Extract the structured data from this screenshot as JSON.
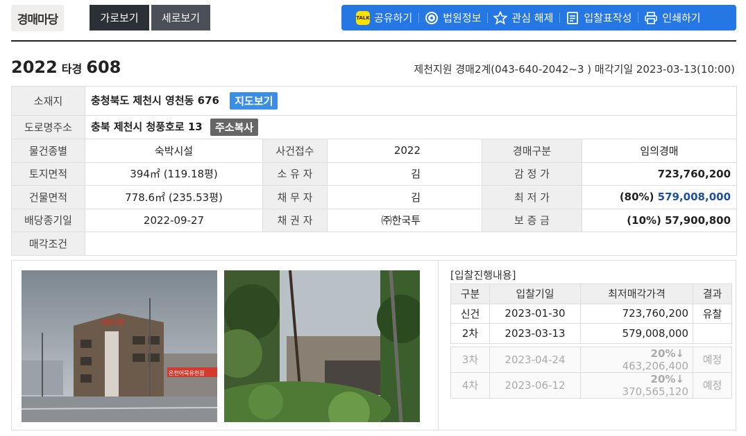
{
  "header": {
    "logo_text": "경매마당",
    "view_horizontal": "가로보기",
    "view_vertical": "세로보기",
    "actions": [
      {
        "icon": "kakao-icon",
        "label": "공유하기"
      },
      {
        "icon": "court-icon",
        "label": "법원정보"
      },
      {
        "icon": "star-icon",
        "label": "관심 해제"
      },
      {
        "icon": "form-icon",
        "label": "입찰표작성"
      },
      {
        "icon": "printer-icon",
        "label": "인쇄하기"
      }
    ],
    "kakao_badge": "TALK"
  },
  "case": {
    "year": "2022",
    "type": "타경",
    "number": "608",
    "court_info": "제천지원 경매2계(043-640-2042~3 ) 매각기일 2023-03-13(10:00)"
  },
  "info": {
    "address_label": "소재지",
    "address_value": "충청북도 제천시 영천동 676",
    "map_button": "지도보기",
    "road_label": "도로명주소",
    "road_value": "충북 제천시 청풍호로 13",
    "copy_button": "주소복사",
    "rows": [
      {
        "l1": "물건종별",
        "v1": "숙박시설",
        "l2": "사건접수",
        "v2": "2022",
        "l3": "경매구분",
        "v3": "임의경매"
      },
      {
        "l1": "토지면적",
        "v1": "394㎡ (119.18평)",
        "l2": "소 유 자",
        "v2": "김",
        "l3": "감 정 가",
        "v3": "723,760,200"
      },
      {
        "l1": "건물면적",
        "v1": "778.6㎡ (235.53평)",
        "l2": "채 무 자",
        "v2": "김",
        "l3": "최 저 가",
        "v3_pct": "(80%)",
        "v3": "579,008,000"
      },
      {
        "l1": "배당종기일",
        "v1": "2022-09-27",
        "l2": "채 권 자",
        "v2": "㈜한국투",
        "l3": "보 증 금",
        "v3": "(10%) 57,900,800"
      }
    ],
    "condition_label": "매각조건"
  },
  "bid": {
    "title": "[입찰진행내용]",
    "headers": [
      "구분",
      "입찰기일",
      "최저매각가격",
      "결과"
    ],
    "rows": [
      {
        "round": "신건",
        "date": "2023-01-30",
        "price": "723,760,200",
        "result": "유찰"
      },
      {
        "round": "2차",
        "date": "2023-03-13",
        "price": "579,008,000",
        "result": ""
      }
    ],
    "future": [
      {
        "round": "3차",
        "date": "2023-04-24",
        "pct": "20%↓",
        "price": "463,206,400",
        "result": "예정"
      },
      {
        "round": "4차",
        "date": "2023-06-12",
        "pct": "20%↓",
        "price": "370,565,120",
        "result": "예정"
      }
    ]
  },
  "photos": {
    "sign_text": "제일모텔",
    "banner_text": "은천어묵유천점"
  }
}
